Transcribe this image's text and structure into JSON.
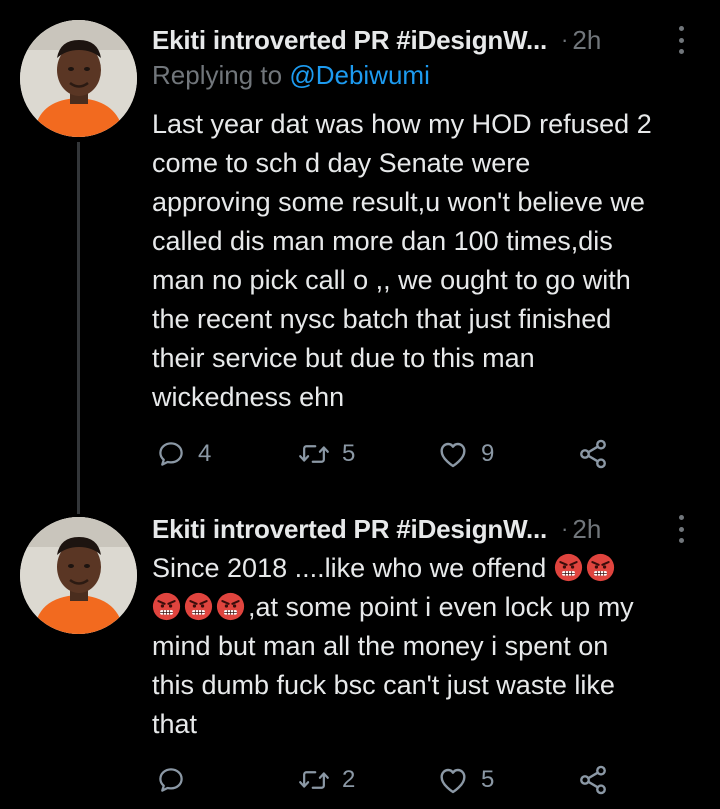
{
  "thread": [
    {
      "author_name": "Ekiti introverted PR #iDesignW...",
      "separator": "·",
      "time": "2h",
      "replying_prefix": "Replying to",
      "replying_handle": "@Debiwumi",
      "lines": [
        "Last year dat was how my HOD refused 2",
        "come to sch d day Senate were",
        "approving some result,u won't believe we",
        "called dis man more dan 100 times,dis",
        "man no pick call o ,, we ought to go with",
        "the recent nysc batch that just finished",
        "their service but due to this man",
        "wickedness ehn"
      ],
      "replies": "4",
      "retweets": "5",
      "likes": "9"
    },
    {
      "author_name": "Ekiti introverted PR #iDesignW...",
      "separator": "·",
      "time": "2h",
      "lines": [
        "Since 2018 ....like who we offend ",
        ",at some point i even lock up my",
        "mind but man all the money i spent on",
        "this dumb fuck bsc can't just waste like",
        "that"
      ],
      "replies": "",
      "retweets": "2",
      "likes": "5"
    }
  ],
  "icons": {
    "reply": "speech-bubble-icon",
    "retweet": "retweet-arrows-icon",
    "like": "heart-icon",
    "share": "share-nodes-icon",
    "emoji": "angry-face-emoji"
  },
  "colors": {
    "background": "#000000",
    "text": "#e7e9ea",
    "muted": "#71767b",
    "link": "#1d9bf0",
    "action": "#8b98a5",
    "emoji": "#e0443e"
  }
}
